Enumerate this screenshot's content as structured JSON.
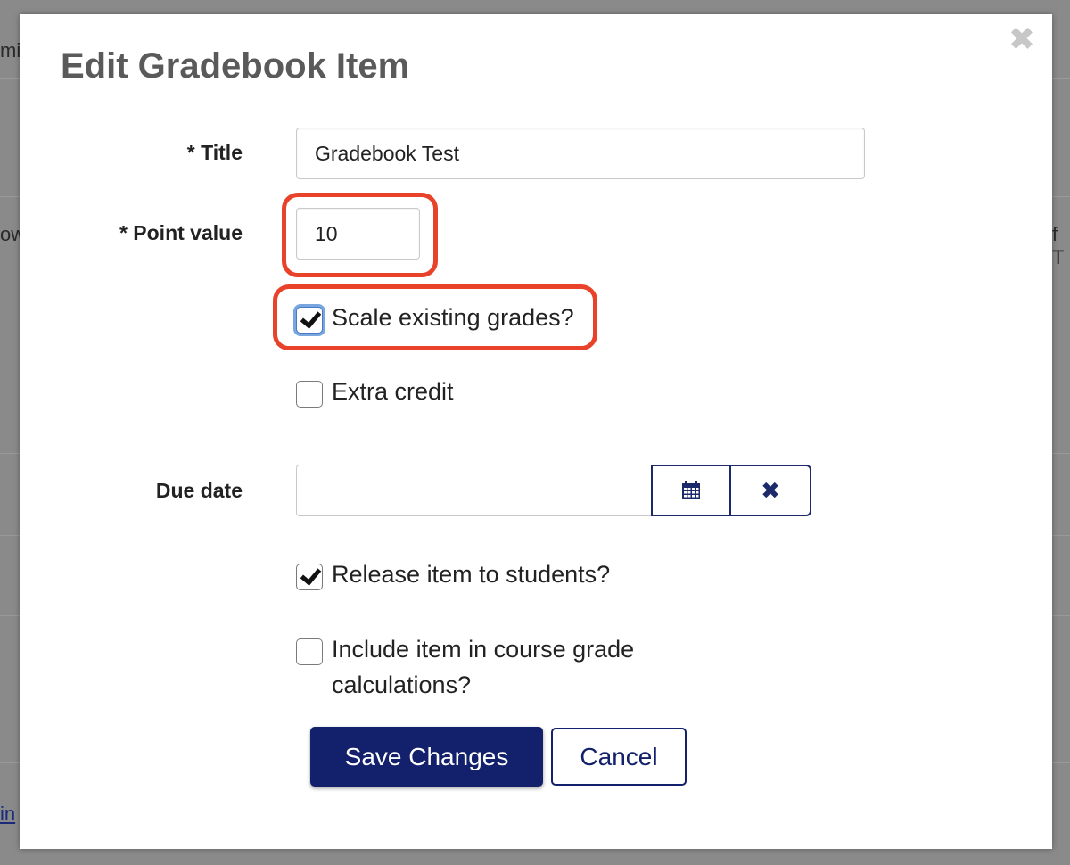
{
  "background": {
    "fragment_top_left": "mi",
    "fragment_mid_left": "ow",
    "fragment_mid_right": "f T",
    "fragment_bottom_left_link": "in"
  },
  "dialog": {
    "title": "Edit Gradebook Item",
    "close_glyph": "✖"
  },
  "form": {
    "title_label": "* Title",
    "title_value": "Gradebook Test",
    "point_label": "* Point value",
    "point_value": "10",
    "scale_label": "Scale existing grades?",
    "scale_checked": true,
    "extra_credit_label": "Extra credit",
    "extra_credit_checked": false,
    "due_date_label": "Due date",
    "due_date_value": "",
    "calendar_icon": "calendar-icon",
    "clear_glyph": "✖",
    "release_label": "Release item to students?",
    "release_checked": true,
    "include_label_line1": "Include item in course grade",
    "include_label_line2": "calculations?",
    "include_checked": false
  },
  "actions": {
    "save_label": "Save Changes",
    "cancel_label": "Cancel"
  },
  "colors": {
    "primary": "#13206b",
    "highlight": "#e8432a",
    "title_text": "#5a5a5a"
  }
}
